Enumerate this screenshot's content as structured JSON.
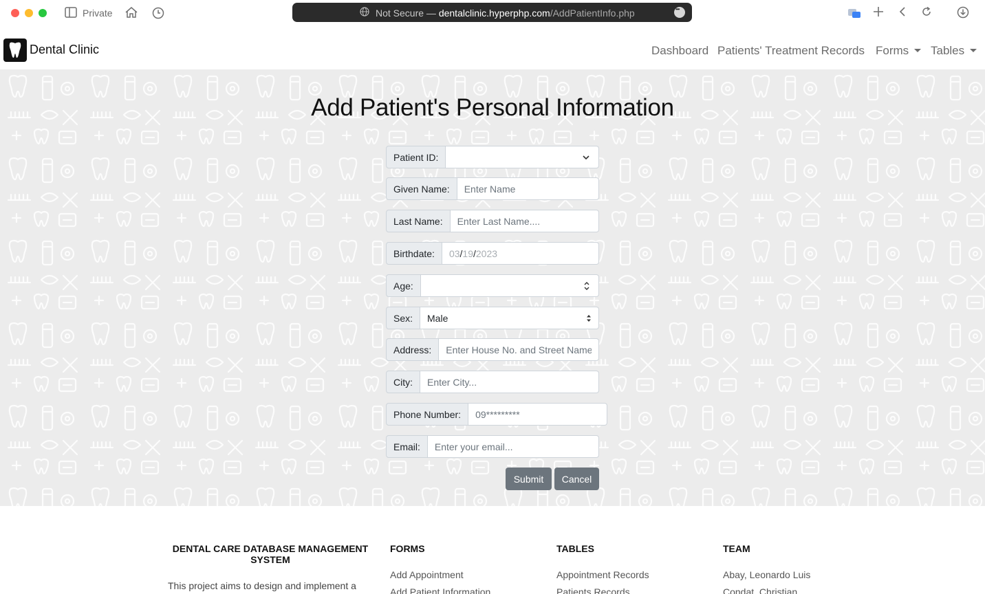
{
  "browser": {
    "private_label": "Private",
    "url_prefix": "Not Secure — ",
    "url_domain": "dentalclinic.hyperphp.com",
    "url_path": "/AddPatientInfo.php"
  },
  "navbar": {
    "brand": "Dental Clinic",
    "links": [
      "Dashboard",
      "Patients' Treatment Records",
      "Forms",
      "Tables"
    ]
  },
  "page": {
    "title": "Add Patient's Personal Information"
  },
  "form": {
    "patient_id": {
      "label": "Patient ID:",
      "value": ""
    },
    "given_name": {
      "label": "Given Name:",
      "placeholder": "Enter Name"
    },
    "last_name": {
      "label": "Last Name:",
      "placeholder": "Enter Last Name...."
    },
    "birthdate": {
      "label": "Birthdate:",
      "month": "03",
      "day": "19",
      "year": "2023",
      "sep": "/"
    },
    "age": {
      "label": "Age:",
      "value": ""
    },
    "sex": {
      "label": "Sex:",
      "value": "Male"
    },
    "address": {
      "label": "Address:",
      "placeholder": "Enter House No. and Street Name"
    },
    "city": {
      "label": "City:",
      "placeholder": "Enter City..."
    },
    "phone": {
      "label": "Phone Number:",
      "placeholder": "09*********"
    },
    "email": {
      "label": "Email:",
      "placeholder": "Enter your email..."
    },
    "submit_label": "Submit",
    "cancel_label": "Cancel"
  },
  "footer": {
    "about_title": "DENTAL CARE DATABASE MANAGEMENT SYSTEM",
    "about_text": "This project aims to design and implement a",
    "forms_title": "FORMS",
    "forms_links": [
      "Add Appointment",
      "Add Patient Information"
    ],
    "tables_title": "TABLES",
    "tables_links": [
      "Appointment Records",
      "Patients Records"
    ],
    "team_title": "TEAM",
    "team_members": [
      "Abay, Leonardo Luis",
      "Condat, Christian"
    ]
  },
  "colors": {
    "background_pattern": "#ececec",
    "button": "#6c757d",
    "input_label_bg": "#e9ecef",
    "input_border": "#ced4da"
  }
}
